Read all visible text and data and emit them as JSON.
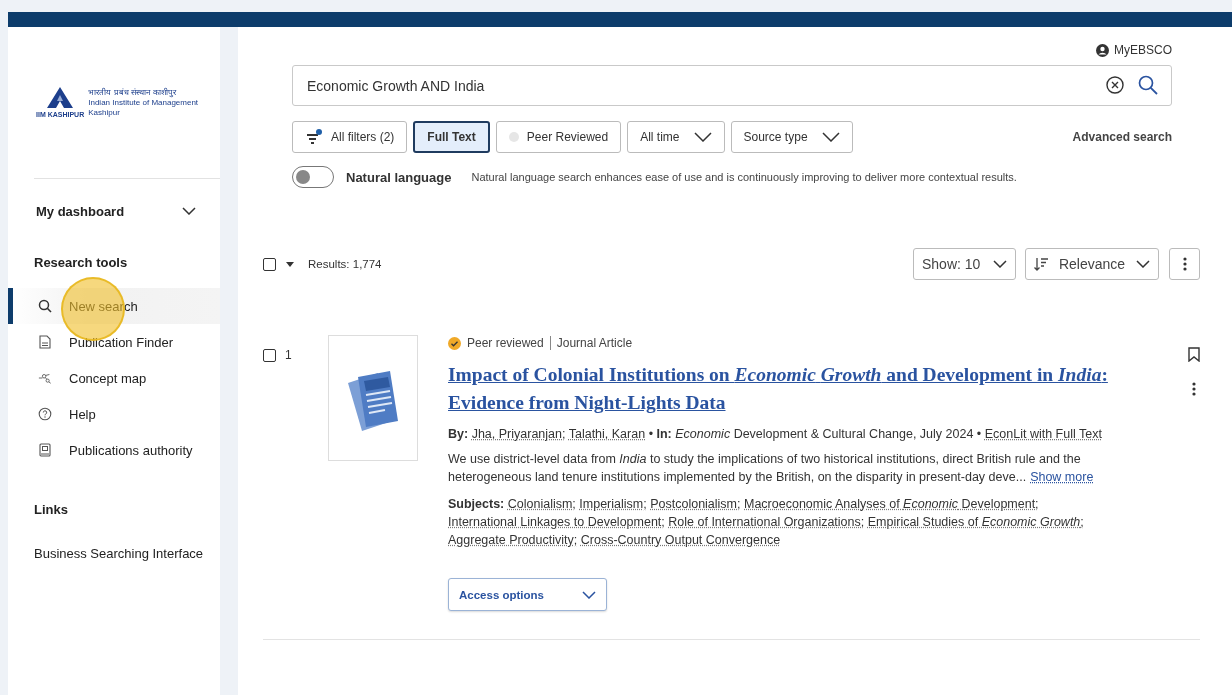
{
  "logo": {
    "hindi": "भारतीय प्रबंध संस्थान काशीपुर",
    "english": "Indian Institute of Management Kashipur",
    "abbr": "IIM KASHIPUR"
  },
  "sidebar": {
    "dashboard": {
      "label": "My dashboard",
      "expanded": false
    },
    "sections": [
      {
        "title": "Research tools",
        "items": [
          {
            "label": "New search",
            "selected": true
          },
          {
            "label": "Publication Finder",
            "selected": false
          },
          {
            "label": "Concept map",
            "selected": false
          },
          {
            "label": "Help",
            "selected": false
          },
          {
            "label": "Publications authority",
            "selected": false
          }
        ]
      },
      {
        "title": "Links",
        "items": [
          {
            "label": "Business Searching Interface",
            "selected": false
          }
        ]
      }
    ]
  },
  "account": {
    "label": "MyEBSCO"
  },
  "search": {
    "value": "Economic Growth AND India"
  },
  "filters": [
    {
      "kind": "filters",
      "label": "All filters (2)"
    },
    {
      "kind": "toggle",
      "label": "Full Text",
      "selected": true
    },
    {
      "kind": "toggle",
      "label": "Peer Reviewed",
      "selected": false
    },
    {
      "kind": "dropdown",
      "label": "All time"
    },
    {
      "kind": "dropdown",
      "label": "Source type"
    }
  ],
  "advanced_search": "Advanced search",
  "natural_language": {
    "label": "Natural language",
    "on": false,
    "description": "Natural language search enhances ease of use and is continuously improving to deliver more contextual results."
  },
  "results_bar": {
    "select_all_checked": false,
    "count": "Results: 1,774",
    "show": "Show: 10",
    "sort": "Relevance"
  },
  "results": [
    {
      "number": "1",
      "checked": false,
      "peer_label": "Peer reviewed",
      "type": "Journal Article",
      "bookmarked": false,
      "title": "Impact of Colonial Institutions on *Economic* *Growth* and Development in *India*: Evidence from Night-Lights Data",
      "by_label": "By:",
      "authors": [
        "Jha, Priyaranjan;",
        "Talathi, Karan"
      ],
      "separator": "•",
      "in_label": "In:",
      "source": "*Economic* Development & Cultural Change, July 2024",
      "database": "EconLit with Full Text",
      "abstract": "We use district-level data from *India* to study the implications of two historical institutions, direct British rule and the heterogeneous land tenure institutions implemented by the British, on the disparity in present-day deve...",
      "show_more": "Show more",
      "subjects_label": "Subjects:",
      "subjects": [
        "Colonialism;",
        "Imperialism;",
        "Postcolonialism;",
        "Macroeconomic Analyses of *Economic* Development;",
        "International Linkages to Development;",
        "Role of International Organizations;",
        "Empirical Studies of *Economic Growth*;",
        "Aggregate Productivity;",
        "Cross-Country Output Convergence"
      ],
      "access": "Access options"
    }
  ]
}
